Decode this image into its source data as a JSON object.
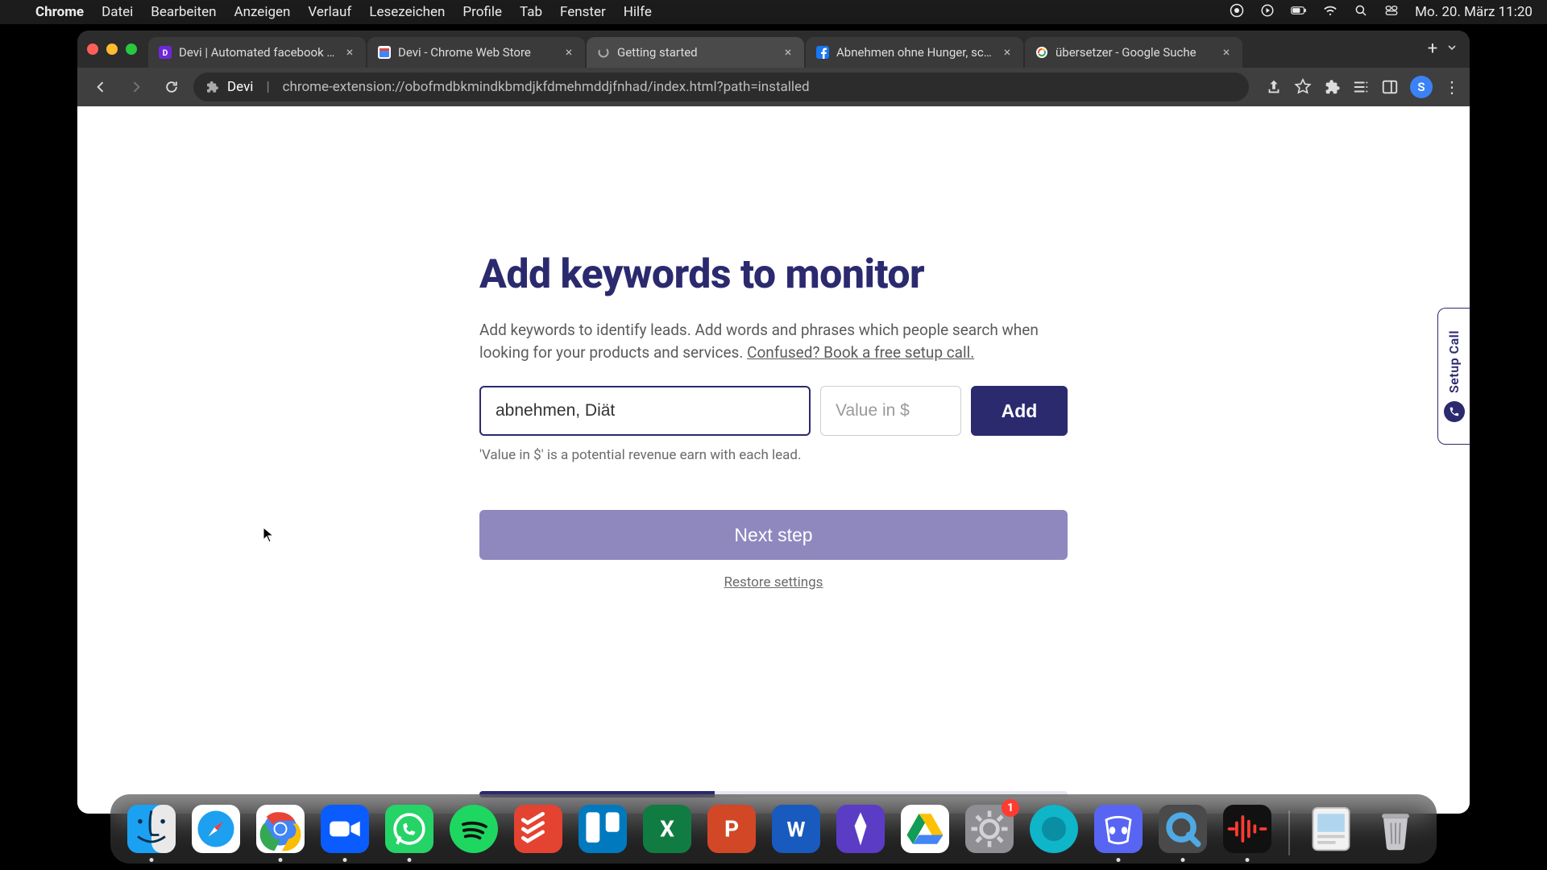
{
  "colors": {
    "primary": "#2b2a6f",
    "nextBtn": "#8f88bf",
    "avatar": "#3b82f6"
  },
  "menubar": {
    "appname": "Chrome",
    "items": [
      "Datei",
      "Bearbeiten",
      "Anzeigen",
      "Verlauf",
      "Lesezeichen",
      "Profile",
      "Tab",
      "Fenster",
      "Hilfe"
    ],
    "clock": "Mo. 20. März  11:20"
  },
  "browser": {
    "tabs": [
      {
        "title": "Devi | Automated facebook gro…",
        "favicon": "devi",
        "active": false
      },
      {
        "title": "Devi - Chrome Web Store",
        "favicon": "webstore",
        "active": false
      },
      {
        "title": "Getting started",
        "favicon": "spinner",
        "active": true
      },
      {
        "title": "Abnehmen ohne Hunger, schn…",
        "favicon": "facebook",
        "active": false
      },
      {
        "title": "übersetzer - Google Suche",
        "favicon": "google",
        "active": false
      }
    ],
    "url_host": "Devi",
    "url_path": "chrome-extension://obofmdbkmindkbmdjkfdmehmddjfnhad/index.html?path=installed",
    "avatar_letter": "S"
  },
  "page": {
    "heading": "Add keywords to monitor",
    "description_a": "Add keywords to identify leads. Add words and phrases which people search when looking for your products and services. ",
    "description_link": "Confused? Book a free setup call.",
    "keyword_value": "abnehmen, Diät",
    "value_placeholder": "Value in $",
    "add_label": "Add",
    "value_hint": "'Value in $' is a potential revenue earn with each lead.",
    "next_label": "Next step",
    "restore_label": "Restore settings",
    "setup_call_label": "Setup Call",
    "progress_pct": 40
  },
  "dock": {
    "apps": [
      {
        "name": "finder",
        "running": true
      },
      {
        "name": "safari",
        "running": false
      },
      {
        "name": "chrome",
        "running": true
      },
      {
        "name": "zoom",
        "running": true
      },
      {
        "name": "whatsapp",
        "running": true
      },
      {
        "name": "spotify",
        "running": false
      },
      {
        "name": "todoist",
        "running": false
      },
      {
        "name": "trello",
        "running": false
      },
      {
        "name": "excel",
        "running": false
      },
      {
        "name": "powerpoint",
        "running": false
      },
      {
        "name": "word",
        "running": false
      },
      {
        "name": "imovie",
        "running": false
      },
      {
        "name": "drive",
        "running": false
      },
      {
        "name": "settings",
        "running": false,
        "badge": "1"
      },
      {
        "name": "siri-blue",
        "running": false
      },
      {
        "name": "discord",
        "running": true
      },
      {
        "name": "quicktime",
        "running": true
      },
      {
        "name": "voice-memos",
        "running": true
      }
    ],
    "right": [
      {
        "name": "preview-doc"
      },
      {
        "name": "trash"
      }
    ]
  }
}
